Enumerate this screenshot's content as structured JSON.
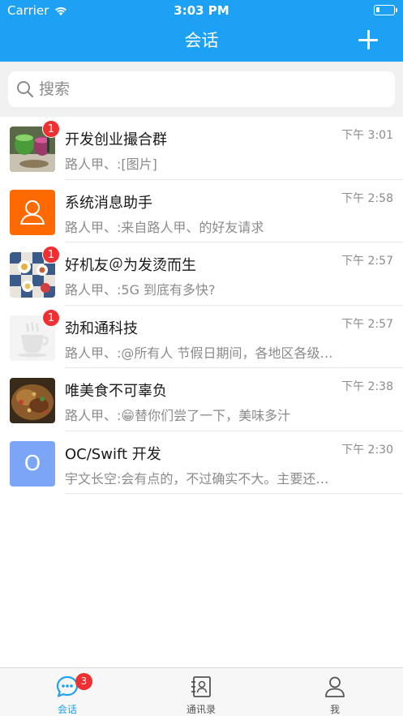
{
  "status_bar": {
    "carrier": "Carrier",
    "time": "3:03 PM"
  },
  "nav": {
    "title": "会话",
    "add_icon": "plus-icon"
  },
  "search": {
    "placeholder": "搜索",
    "value": ""
  },
  "conversations": [
    {
      "title": "开发创业撮合群",
      "preview": "路人甲、:[图片]",
      "time": "下午 3:01",
      "unread": "1",
      "avatar": "photo-smoothies"
    },
    {
      "title": "系统消息助手",
      "preview": "路人甲、:来自路人甲、的好友请求",
      "time": "下午 2:58",
      "unread": "",
      "avatar": "person-icon"
    },
    {
      "title": "好机友＠为发烫而生",
      "preview": "路人甲、:5G 到底有多快?",
      "time": "下午 2:57",
      "unread": "1",
      "avatar": "photo-breakfast-table"
    },
    {
      "title": "劲和通科技",
      "preview": "路人甲、:@所有人 节假日期间，各地区各级…",
      "time": "下午 2:57",
      "unread": "1",
      "avatar": "coffee-cup-icon"
    },
    {
      "title": "唯美食不可辜负",
      "preview": "路人甲、:😁替你们尝了一下，美味多汁",
      "time": "下午 2:38",
      "unread": "",
      "avatar": "photo-food"
    },
    {
      "title": "OC/Swift 开发",
      "preview": "宇文长空:会有点的，不过确实不大。主要还是…",
      "time": "下午 2:30",
      "unread": "",
      "avatar": "O"
    }
  ],
  "tabbar": {
    "tabs": [
      {
        "label": "会话",
        "icon": "chat-bubble-icon",
        "badge": "3",
        "active": true
      },
      {
        "label": "通讯录",
        "icon": "contacts-book-icon",
        "badge": "",
        "active": false
      },
      {
        "label": "我",
        "icon": "person-icon",
        "badge": "",
        "active": false
      }
    ]
  },
  "colors": {
    "accent": "#1da1f5",
    "badge": "#f03030",
    "system_avatar": "#ff6a00",
    "letter_avatar": "#7aa6f5"
  }
}
